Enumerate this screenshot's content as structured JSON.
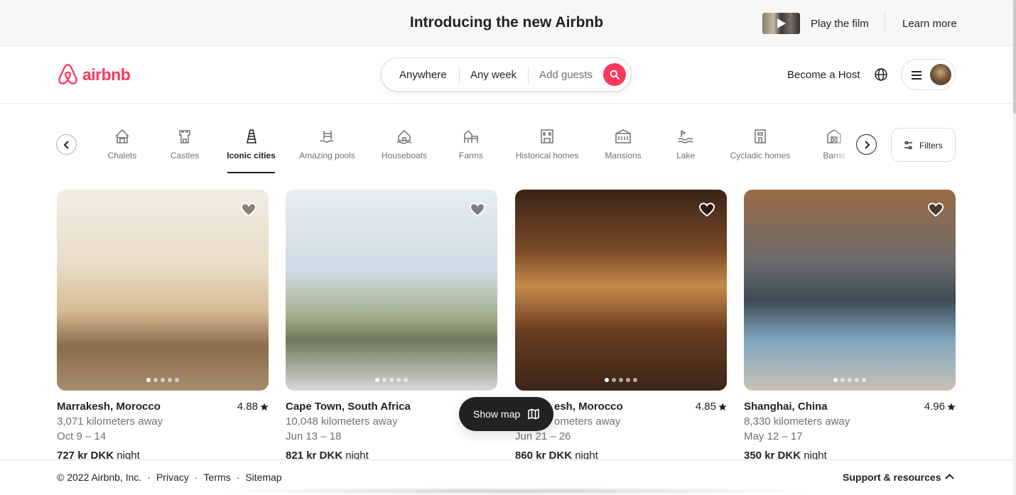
{
  "banner": {
    "title": "Introducing the new Airbnb",
    "play_label": "Play the film",
    "learn_label": "Learn more"
  },
  "header": {
    "logo_text": "airbnb",
    "brand_color": "#ff385c",
    "search": {
      "anywhere": "Anywhere",
      "week": "Any week",
      "guests": "Add guests"
    },
    "become_host": "Become a Host"
  },
  "categories": {
    "items": [
      {
        "label": "Chalets",
        "icon": "chalet-icon",
        "active": false
      },
      {
        "label": "Castles",
        "icon": "castle-icon",
        "active": false
      },
      {
        "label": "Iconic cities",
        "icon": "iconic-cities-icon",
        "active": true
      },
      {
        "label": "Amazing pools",
        "icon": "pool-icon",
        "active": false
      },
      {
        "label": "Houseboats",
        "icon": "houseboat-icon",
        "active": false
      },
      {
        "label": "Farms",
        "icon": "farm-icon",
        "active": false
      },
      {
        "label": "Historical homes",
        "icon": "historical-home-icon",
        "active": false
      },
      {
        "label": "Mansions",
        "icon": "mansion-icon",
        "active": false
      },
      {
        "label": "Lake",
        "icon": "lake-icon",
        "active": false
      },
      {
        "label": "Cycladic homes",
        "icon": "cycladic-home-icon",
        "active": false
      },
      {
        "label": "Barns",
        "icon": "barn-icon",
        "active": false
      }
    ],
    "filters_label": "Filters"
  },
  "listings": [
    {
      "title": "Marrakesh, Morocco",
      "rating": "4.88",
      "distance": "3,071 kilometers away",
      "dates": "Oct 9 – 14",
      "price": "727 kr DKK",
      "price_unit": "night"
    },
    {
      "title": "Cape Town, South Africa",
      "rating": "",
      "distance": "10,048 kilometers away",
      "dates": "Jun 13 – 18",
      "price": "821 kr DKK",
      "price_unit": "night"
    },
    {
      "title": "esh, Morocco",
      "rating": "4.85",
      "distance": "ometers away",
      "dates": "Jun 21 – 26",
      "price": "860 kr DKK",
      "price_unit": "night"
    },
    {
      "title": "Shanghai, China",
      "rating": "4.96",
      "distance": "8,330 kilometers away",
      "dates": "May 12 – 17",
      "price": "350 kr DKK",
      "price_unit": "night"
    }
  ],
  "show_map_label": "Show map",
  "footer": {
    "copyright": "© 2022 Airbnb, Inc.",
    "sep": "·",
    "privacy": "Privacy",
    "terms": "Terms",
    "sitemap": "Sitemap",
    "support": "Support & resources"
  }
}
